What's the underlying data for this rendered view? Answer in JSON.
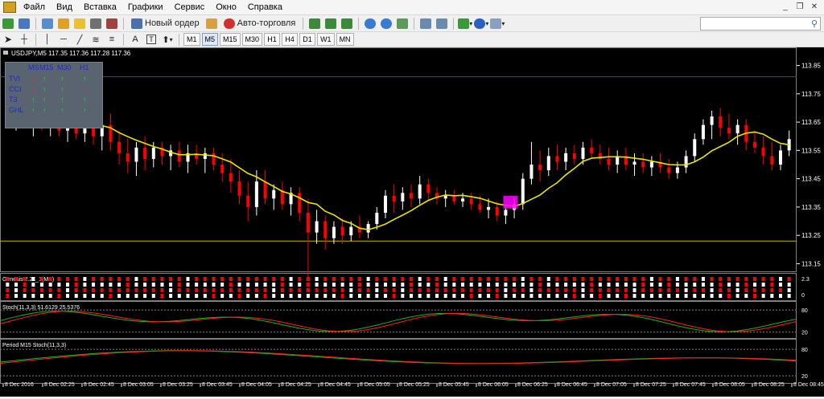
{
  "menu": [
    "Файл",
    "Вид",
    "Вставка",
    "Графики",
    "Сервис",
    "Окно",
    "Справка"
  ],
  "toolbar": {
    "new_order": "Новый ордер",
    "auto_trading": "Авто-торговля"
  },
  "timeframes": [
    "M1",
    "M5",
    "M15",
    "M30",
    "H1",
    "H4",
    "D1",
    "W1",
    "MN"
  ],
  "active_timeframe": "M5",
  "chart": {
    "header": "USDJPY,M5  117.35 117.36 117.28 117.36",
    "price_labels": [
      "113.85",
      "113.75",
      "113.65",
      "113.55",
      "113.45",
      "113.35",
      "113.25",
      "113.15"
    ],
    "h_lines": [
      113.81,
      113.23
    ],
    "time_labels": [
      "8 Dec 2016",
      "8 Dec 02:25",
      "8 Dec 02:45",
      "8 Dec 03:05",
      "8 Dec 03:25",
      "8 Dec 03:45",
      "8 Dec 04:05",
      "8 Dec 04:25",
      "8 Dec 04:45",
      "8 Dec 05:05",
      "8 Dec 05:25",
      "8 Dec 05:45",
      "8 Dec 06:05",
      "8 Dec 06:25",
      "8 Dec 06:45",
      "8 Dec 07:05",
      "8 Dec 07:25",
      "8 Dec 07:45",
      "8 Dec 08:05",
      "8 Dec 08:25",
      "8 Dec 08:45"
    ],
    "colors": {
      "bull": "#ffffff",
      "bear": "#ff0000",
      "ma": "#e6e600",
      "hline_top": "#3050a0",
      "hline_bottom": "#c8b400",
      "highlight": "#ff00ff"
    }
  },
  "mtf_panel": {
    "header": [
      "MS",
      "M15",
      "M30",
      "H1"
    ],
    "rows": [
      {
        "name": "TVI",
        "signals": [
          "down",
          "up",
          "up",
          "up"
        ]
      },
      {
        "name": "CCI",
        "signals": [
          "down",
          "up",
          "up",
          "down"
        ]
      },
      {
        "name": "T3",
        "signals": [
          "up",
          "up",
          "up",
          "up"
        ]
      },
      {
        "name": "GHL",
        "signals": [
          "up",
          "up",
          "up",
          "up"
        ]
      }
    ]
  },
  "genesis": {
    "label": "Genesis 2.21_1(MS)",
    "scale": [
      "2.3",
      "0"
    ]
  },
  "stoch": {
    "label": "Stoch(11,3,3) 51.6129 25.5376",
    "scale": [
      "80",
      "20"
    ]
  },
  "stoch_m15": {
    "label": "Period M15 Stoch(11,3,3)",
    "scale": [
      "80",
      "20"
    ]
  },
  "chart_data": {
    "type": "candlestick",
    "symbol": "USDJPY",
    "timeframe": "M5",
    "ylim": [
      113.12,
      113.88
    ],
    "candles": [
      [
        113.7,
        113.76,
        113.63,
        113.68
      ],
      [
        113.68,
        113.74,
        113.62,
        113.7
      ],
      [
        113.7,
        113.75,
        113.63,
        113.66
      ],
      [
        113.66,
        113.72,
        113.6,
        113.69
      ],
      [
        113.69,
        113.73,
        113.62,
        113.64
      ],
      [
        113.64,
        113.7,
        113.6,
        113.68
      ],
      [
        113.68,
        113.71,
        113.6,
        113.62
      ],
      [
        113.62,
        113.68,
        113.58,
        113.66
      ],
      [
        113.66,
        113.7,
        113.59,
        113.61
      ],
      [
        113.61,
        113.67,
        113.58,
        113.65
      ],
      [
        113.65,
        113.69,
        113.57,
        113.6
      ],
      [
        113.6,
        113.66,
        113.55,
        113.64
      ],
      [
        113.64,
        113.68,
        113.55,
        113.58
      ],
      [
        113.58,
        113.62,
        113.5,
        113.54
      ],
      [
        113.54,
        113.59,
        113.47,
        113.51
      ],
      [
        113.51,
        113.58,
        113.46,
        113.56
      ],
      [
        113.56,
        113.6,
        113.48,
        113.52
      ],
      [
        113.52,
        113.58,
        113.49,
        113.56
      ],
      [
        113.56,
        113.58,
        113.5,
        113.53
      ],
      [
        113.53,
        113.57,
        113.48,
        113.55
      ],
      [
        113.55,
        113.58,
        113.49,
        113.51
      ],
      [
        113.51,
        113.57,
        113.47,
        113.54
      ],
      [
        113.54,
        113.57,
        113.5,
        113.52
      ],
      [
        113.52,
        113.56,
        113.47,
        113.54
      ],
      [
        113.54,
        113.56,
        113.48,
        113.5
      ],
      [
        113.5,
        113.54,
        113.44,
        113.47
      ],
      [
        113.47,
        113.52,
        113.4,
        113.44
      ],
      [
        113.44,
        113.48,
        113.36,
        113.39
      ],
      [
        113.39,
        113.44,
        113.3,
        113.35
      ],
      [
        113.35,
        113.48,
        113.32,
        113.44
      ],
      [
        113.44,
        113.48,
        113.36,
        113.38
      ],
      [
        113.38,
        113.43,
        113.34,
        113.41
      ],
      [
        113.41,
        113.44,
        113.34,
        113.36
      ],
      [
        113.36,
        113.42,
        113.32,
        113.4
      ],
      [
        113.4,
        113.42,
        113.3,
        113.33
      ],
      [
        113.33,
        113.38,
        113.1,
        113.26
      ],
      [
        113.26,
        113.34,
        113.22,
        113.3
      ],
      [
        113.3,
        113.32,
        113.2,
        113.24
      ],
      [
        113.24,
        113.3,
        113.22,
        113.28
      ],
      [
        113.28,
        113.31,
        113.22,
        113.25
      ],
      [
        113.25,
        113.3,
        113.23,
        113.28
      ],
      [
        113.28,
        113.32,
        113.24,
        113.26
      ],
      [
        113.26,
        113.3,
        113.24,
        113.29
      ],
      [
        113.29,
        113.35,
        113.27,
        113.33
      ],
      [
        113.33,
        113.41,
        113.31,
        113.39
      ],
      [
        113.39,
        113.43,
        113.33,
        113.37
      ],
      [
        113.37,
        113.42,
        113.34,
        113.4
      ],
      [
        113.4,
        113.43,
        113.35,
        113.38
      ],
      [
        113.38,
        113.46,
        113.36,
        113.43
      ],
      [
        113.43,
        113.45,
        113.37,
        113.4
      ],
      [
        113.4,
        113.42,
        113.36,
        113.38
      ],
      [
        113.38,
        113.41,
        113.35,
        113.39
      ],
      [
        113.39,
        113.41,
        113.36,
        113.37
      ],
      [
        113.37,
        113.4,
        113.35,
        113.38
      ],
      [
        113.38,
        113.4,
        113.34,
        113.36
      ],
      [
        113.36,
        113.39,
        113.33,
        113.34
      ],
      [
        113.34,
        113.38,
        113.31,
        113.35
      ],
      [
        113.35,
        113.37,
        113.3,
        113.32
      ],
      [
        113.32,
        113.36,
        113.29,
        113.34
      ],
      [
        113.34,
        113.38,
        113.31,
        113.36
      ],
      [
        113.36,
        113.47,
        113.34,
        113.45
      ],
      [
        113.45,
        113.58,
        113.43,
        113.5
      ],
      [
        113.5,
        113.55,
        113.44,
        113.48
      ],
      [
        113.48,
        113.56,
        113.46,
        113.53
      ],
      [
        113.53,
        113.57,
        113.48,
        113.51
      ],
      [
        113.51,
        113.56,
        113.48,
        113.54
      ],
      [
        113.54,
        113.57,
        113.5,
        113.52
      ],
      [
        113.52,
        113.58,
        113.5,
        113.56
      ],
      [
        113.56,
        113.59,
        113.52,
        113.54
      ],
      [
        113.54,
        113.57,
        113.5,
        113.52
      ],
      [
        113.52,
        113.56,
        113.48,
        113.5
      ],
      [
        113.5,
        113.55,
        113.47,
        113.53
      ],
      [
        113.53,
        113.56,
        113.48,
        113.5
      ],
      [
        113.5,
        113.54,
        113.46,
        113.51
      ],
      [
        113.51,
        113.54,
        113.47,
        113.49
      ],
      [
        113.49,
        113.53,
        113.46,
        113.51
      ],
      [
        113.51,
        113.54,
        113.47,
        113.49
      ],
      [
        113.49,
        113.52,
        113.45,
        113.47
      ],
      [
        113.47,
        113.51,
        113.45,
        113.49
      ],
      [
        113.49,
        113.55,
        113.47,
        113.53
      ],
      [
        113.53,
        113.61,
        113.51,
        113.59
      ],
      [
        113.59,
        113.66,
        113.57,
        113.64
      ],
      [
        113.64,
        113.69,
        113.59,
        113.67
      ],
      [
        113.67,
        113.7,
        113.6,
        113.63
      ],
      [
        113.63,
        113.68,
        113.59,
        113.61
      ],
      [
        113.61,
        113.66,
        113.57,
        113.64
      ],
      [
        113.64,
        113.66,
        113.55,
        113.58
      ],
      [
        113.58,
        113.62,
        113.54,
        113.56
      ],
      [
        113.56,
        113.6,
        113.5,
        113.53
      ],
      [
        113.53,
        113.58,
        113.48,
        113.5
      ],
      [
        113.5,
        113.57,
        113.48,
        113.55
      ],
      [
        113.55,
        113.62,
        113.53,
        113.59
      ]
    ],
    "ma_period": 8
  }
}
